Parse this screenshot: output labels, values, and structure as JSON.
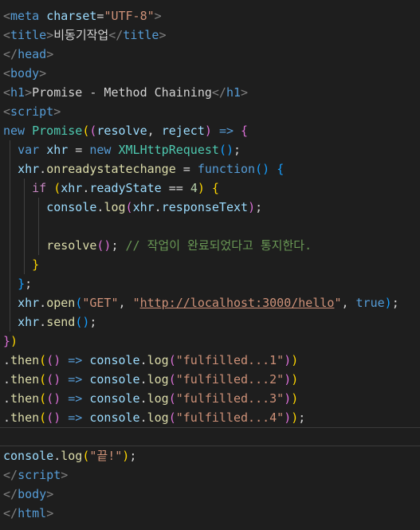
{
  "editor": {
    "colors": {
      "background": "#1e1e1e",
      "tag": "#808080",
      "tag_name": "#569cd6",
      "attribute": "#9cdcfe",
      "string": "#ce9178",
      "keyword": "#569cd6",
      "control": "#c586c0",
      "class": "#4ec9b0",
      "function": "#dcdcaa",
      "variable": "#9cdcfe",
      "number": "#b5cea8",
      "comment": "#6a9955",
      "text": "#d4d4d4",
      "bracket_gold": "#ffd700",
      "bracket_purple": "#da70d6",
      "bracket_blue": "#179fff"
    },
    "lines": [
      [
        {
          "t": "<",
          "c": "tag"
        },
        {
          "t": "meta",
          "c": "tag_name"
        },
        {
          "t": " ",
          "c": "text"
        },
        {
          "t": "charset",
          "c": "attribute"
        },
        {
          "t": "=",
          "c": "text"
        },
        {
          "t": "\"UTF-8\"",
          "c": "string"
        },
        {
          "t": ">",
          "c": "tag"
        }
      ],
      [
        {
          "t": "<",
          "c": "tag"
        },
        {
          "t": "title",
          "c": "tag_name"
        },
        {
          "t": ">",
          "c": "tag"
        },
        {
          "t": "비동기작업",
          "c": "text"
        },
        {
          "t": "</",
          "c": "tag"
        },
        {
          "t": "title",
          "c": "tag_name"
        },
        {
          "t": ">",
          "c": "tag"
        }
      ],
      [
        {
          "t": "</",
          "c": "tag"
        },
        {
          "t": "head",
          "c": "tag_name"
        },
        {
          "t": ">",
          "c": "tag"
        }
      ],
      [
        {
          "t": "<",
          "c": "tag"
        },
        {
          "t": "body",
          "c": "tag_name"
        },
        {
          "t": ">",
          "c": "tag"
        }
      ],
      [
        {
          "t": "<",
          "c": "tag"
        },
        {
          "t": "h1",
          "c": "tag_name"
        },
        {
          "t": ">",
          "c": "tag"
        },
        {
          "t": "Promise - Method Chaining",
          "c": "text"
        },
        {
          "t": "</",
          "c": "tag"
        },
        {
          "t": "h1",
          "c": "tag_name"
        },
        {
          "t": ">",
          "c": "tag"
        }
      ],
      [
        {
          "t": "<",
          "c": "tag"
        },
        {
          "t": "script",
          "c": "tag_name"
        },
        {
          "t": ">",
          "c": "tag"
        }
      ],
      [
        {
          "t": "new",
          "c": "keyword"
        },
        {
          "t": " ",
          "c": "text"
        },
        {
          "t": "Promise",
          "c": "class"
        },
        {
          "t": "(",
          "c": "bracket_gold"
        },
        {
          "t": "(",
          "c": "bracket_purple"
        },
        {
          "t": "resolve",
          "c": "variable"
        },
        {
          "t": ", ",
          "c": "text"
        },
        {
          "t": "reject",
          "c": "variable"
        },
        {
          "t": ")",
          "c": "bracket_purple"
        },
        {
          "t": " ",
          "c": "text"
        },
        {
          "t": "=>",
          "c": "keyword"
        },
        {
          "t": " ",
          "c": "text"
        },
        {
          "t": "{",
          "c": "bracket_purple"
        }
      ],
      [
        {
          "t": "  ",
          "c": "text"
        },
        {
          "t": "var",
          "c": "keyword"
        },
        {
          "t": " ",
          "c": "text"
        },
        {
          "t": "xhr",
          "c": "variable"
        },
        {
          "t": " = ",
          "c": "text"
        },
        {
          "t": "new",
          "c": "keyword"
        },
        {
          "t": " ",
          "c": "text"
        },
        {
          "t": "XMLHttpRequest",
          "c": "class"
        },
        {
          "t": "()",
          "c": "bracket_blue"
        },
        {
          "t": ";",
          "c": "text"
        }
      ],
      [
        {
          "t": "  ",
          "c": "text"
        },
        {
          "t": "xhr",
          "c": "variable"
        },
        {
          "t": ".",
          "c": "text"
        },
        {
          "t": "onreadystatechange",
          "c": "function"
        },
        {
          "t": " = ",
          "c": "text"
        },
        {
          "t": "function",
          "c": "keyword"
        },
        {
          "t": "()",
          "c": "bracket_blue"
        },
        {
          "t": " ",
          "c": "text"
        },
        {
          "t": "{",
          "c": "bracket_blue"
        }
      ],
      [
        {
          "t": "    ",
          "c": "text"
        },
        {
          "t": "if",
          "c": "control"
        },
        {
          "t": " ",
          "c": "text"
        },
        {
          "t": "(",
          "c": "bracket_gold"
        },
        {
          "t": "xhr",
          "c": "variable"
        },
        {
          "t": ".",
          "c": "text"
        },
        {
          "t": "readyState",
          "c": "variable"
        },
        {
          "t": " == ",
          "c": "text"
        },
        {
          "t": "4",
          "c": "number"
        },
        {
          "t": ")",
          "c": "bracket_gold"
        },
        {
          "t": " ",
          "c": "text"
        },
        {
          "t": "{",
          "c": "bracket_gold"
        }
      ],
      [
        {
          "t": "      ",
          "c": "text"
        },
        {
          "t": "console",
          "c": "variable"
        },
        {
          "t": ".",
          "c": "text"
        },
        {
          "t": "log",
          "c": "function"
        },
        {
          "t": "(",
          "c": "bracket_purple"
        },
        {
          "t": "xhr",
          "c": "variable"
        },
        {
          "t": ".",
          "c": "text"
        },
        {
          "t": "responseText",
          "c": "variable"
        },
        {
          "t": ")",
          "c": "bracket_purple"
        },
        {
          "t": ";",
          "c": "text"
        }
      ],
      [],
      [
        {
          "t": "      ",
          "c": "text"
        },
        {
          "t": "resolve",
          "c": "function"
        },
        {
          "t": "()",
          "c": "bracket_purple"
        },
        {
          "t": "; ",
          "c": "text"
        },
        {
          "t": "// 작업이 완료되었다고 통지한다.",
          "c": "comment"
        }
      ],
      [
        {
          "t": "    ",
          "c": "text"
        },
        {
          "t": "}",
          "c": "bracket_gold"
        }
      ],
      [
        {
          "t": "  ",
          "c": "text"
        },
        {
          "t": "}",
          "c": "bracket_blue"
        },
        {
          "t": ";",
          "c": "text"
        }
      ],
      [
        {
          "t": "  ",
          "c": "text"
        },
        {
          "t": "xhr",
          "c": "variable"
        },
        {
          "t": ".",
          "c": "text"
        },
        {
          "t": "open",
          "c": "function"
        },
        {
          "t": "(",
          "c": "bracket_blue"
        },
        {
          "t": "\"GET\"",
          "c": "string"
        },
        {
          "t": ", ",
          "c": "text"
        },
        {
          "t": "\"",
          "c": "string"
        },
        {
          "t": "http://localhost:3000/hello",
          "c": "string",
          "u": true
        },
        {
          "t": "\"",
          "c": "string"
        },
        {
          "t": ", ",
          "c": "text"
        },
        {
          "t": "true",
          "c": "keyword"
        },
        {
          "t": ")",
          "c": "bracket_blue"
        },
        {
          "t": ";",
          "c": "text"
        }
      ],
      [
        {
          "t": "  ",
          "c": "text"
        },
        {
          "t": "xhr",
          "c": "variable"
        },
        {
          "t": ".",
          "c": "text"
        },
        {
          "t": "send",
          "c": "function"
        },
        {
          "t": "()",
          "c": "bracket_blue"
        },
        {
          "t": ";",
          "c": "text"
        }
      ],
      [
        {
          "t": "}",
          "c": "bracket_purple"
        },
        {
          "t": ")",
          "c": "bracket_gold"
        }
      ],
      [
        {
          "t": ".",
          "c": "text"
        },
        {
          "t": "then",
          "c": "function"
        },
        {
          "t": "(",
          "c": "bracket_gold"
        },
        {
          "t": "()",
          "c": "bracket_purple"
        },
        {
          "t": " ",
          "c": "text"
        },
        {
          "t": "=>",
          "c": "keyword"
        },
        {
          "t": " ",
          "c": "text"
        },
        {
          "t": "console",
          "c": "variable"
        },
        {
          "t": ".",
          "c": "text"
        },
        {
          "t": "log",
          "c": "function"
        },
        {
          "t": "(",
          "c": "bracket_purple"
        },
        {
          "t": "\"fulfilled...1\"",
          "c": "string"
        },
        {
          "t": ")",
          "c": "bracket_purple"
        },
        {
          "t": ")",
          "c": "bracket_gold"
        }
      ],
      [
        {
          "t": ".",
          "c": "text"
        },
        {
          "t": "then",
          "c": "function"
        },
        {
          "t": "(",
          "c": "bracket_gold"
        },
        {
          "t": "()",
          "c": "bracket_purple"
        },
        {
          "t": " ",
          "c": "text"
        },
        {
          "t": "=>",
          "c": "keyword"
        },
        {
          "t": " ",
          "c": "text"
        },
        {
          "t": "console",
          "c": "variable"
        },
        {
          "t": ".",
          "c": "text"
        },
        {
          "t": "log",
          "c": "function"
        },
        {
          "t": "(",
          "c": "bracket_purple"
        },
        {
          "t": "\"fulfilled...2\"",
          "c": "string"
        },
        {
          "t": ")",
          "c": "bracket_purple"
        },
        {
          "t": ")",
          "c": "bracket_gold"
        }
      ],
      [
        {
          "t": ".",
          "c": "text"
        },
        {
          "t": "then",
          "c": "function"
        },
        {
          "t": "(",
          "c": "bracket_gold"
        },
        {
          "t": "()",
          "c": "bracket_purple"
        },
        {
          "t": " ",
          "c": "text"
        },
        {
          "t": "=>",
          "c": "keyword"
        },
        {
          "t": " ",
          "c": "text"
        },
        {
          "t": "console",
          "c": "variable"
        },
        {
          "t": ".",
          "c": "text"
        },
        {
          "t": "log",
          "c": "function"
        },
        {
          "t": "(",
          "c": "bracket_purple"
        },
        {
          "t": "\"fulfilled...3\"",
          "c": "string"
        },
        {
          "t": ")",
          "c": "bracket_purple"
        },
        {
          "t": ")",
          "c": "bracket_gold"
        }
      ],
      [
        {
          "t": ".",
          "c": "text"
        },
        {
          "t": "then",
          "c": "function"
        },
        {
          "t": "(",
          "c": "bracket_gold"
        },
        {
          "t": "()",
          "c": "bracket_purple"
        },
        {
          "t": " ",
          "c": "text"
        },
        {
          "t": "=>",
          "c": "keyword"
        },
        {
          "t": " ",
          "c": "text"
        },
        {
          "t": "console",
          "c": "variable"
        },
        {
          "t": ".",
          "c": "text"
        },
        {
          "t": "log",
          "c": "function"
        },
        {
          "t": "(",
          "c": "bracket_purple"
        },
        {
          "t": "\"fulfilled...4\"",
          "c": "string"
        },
        {
          "t": ")",
          "c": "bracket_purple"
        },
        {
          "t": ")",
          "c": "bracket_gold"
        },
        {
          "t": ";",
          "c": "text"
        }
      ],
      [],
      [
        {
          "t": "console",
          "c": "variable"
        },
        {
          "t": ".",
          "c": "text"
        },
        {
          "t": "log",
          "c": "function"
        },
        {
          "t": "(",
          "c": "bracket_gold"
        },
        {
          "t": "\"끝!\"",
          "c": "string"
        },
        {
          "t": ")",
          "c": "bracket_gold"
        },
        {
          "t": ";",
          "c": "text"
        }
      ],
      [
        {
          "t": "</",
          "c": "tag"
        },
        {
          "t": "script",
          "c": "tag_name"
        },
        {
          "t": ">",
          "c": "tag"
        }
      ],
      [
        {
          "t": "</",
          "c": "tag"
        },
        {
          "t": "body",
          "c": "tag_name"
        },
        {
          "t": ">",
          "c": "tag"
        }
      ],
      [
        {
          "t": "</",
          "c": "tag"
        },
        {
          "t": "html",
          "c": "tag_name"
        },
        {
          "t": ">",
          "c": "tag"
        }
      ]
    ]
  }
}
